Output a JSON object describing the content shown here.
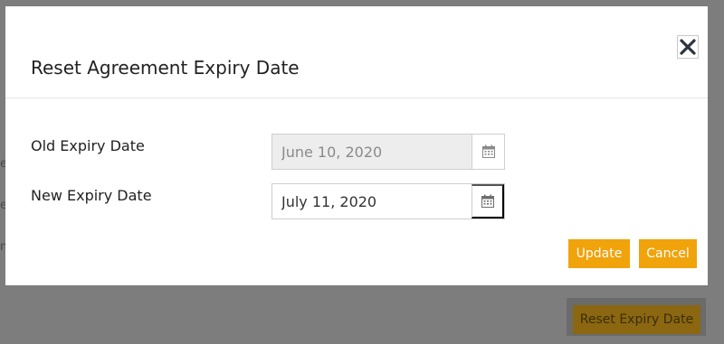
{
  "background": {
    "reset_expiry_button_label": "Reset Expiry Date",
    "stub_texts": [
      "e",
      "e",
      "n"
    ]
  },
  "modal": {
    "title": "Reset Agreement Expiry Date",
    "close_icon": "close-icon",
    "fields": {
      "old_expiry": {
        "label": "Old Expiry Date",
        "value": "June 10, 2020",
        "disabled": true,
        "icon": "calendar-icon"
      },
      "new_expiry": {
        "label": "New Expiry Date",
        "value": "July 11, 2020",
        "disabled": false,
        "icon": "calendar-icon"
      }
    },
    "buttons": {
      "update_label": "Update",
      "cancel_label": "Cancel"
    }
  },
  "colors": {
    "accent": "#f0a30a",
    "overlay": "#7d7d7d",
    "disabled_field": "#ededed"
  }
}
